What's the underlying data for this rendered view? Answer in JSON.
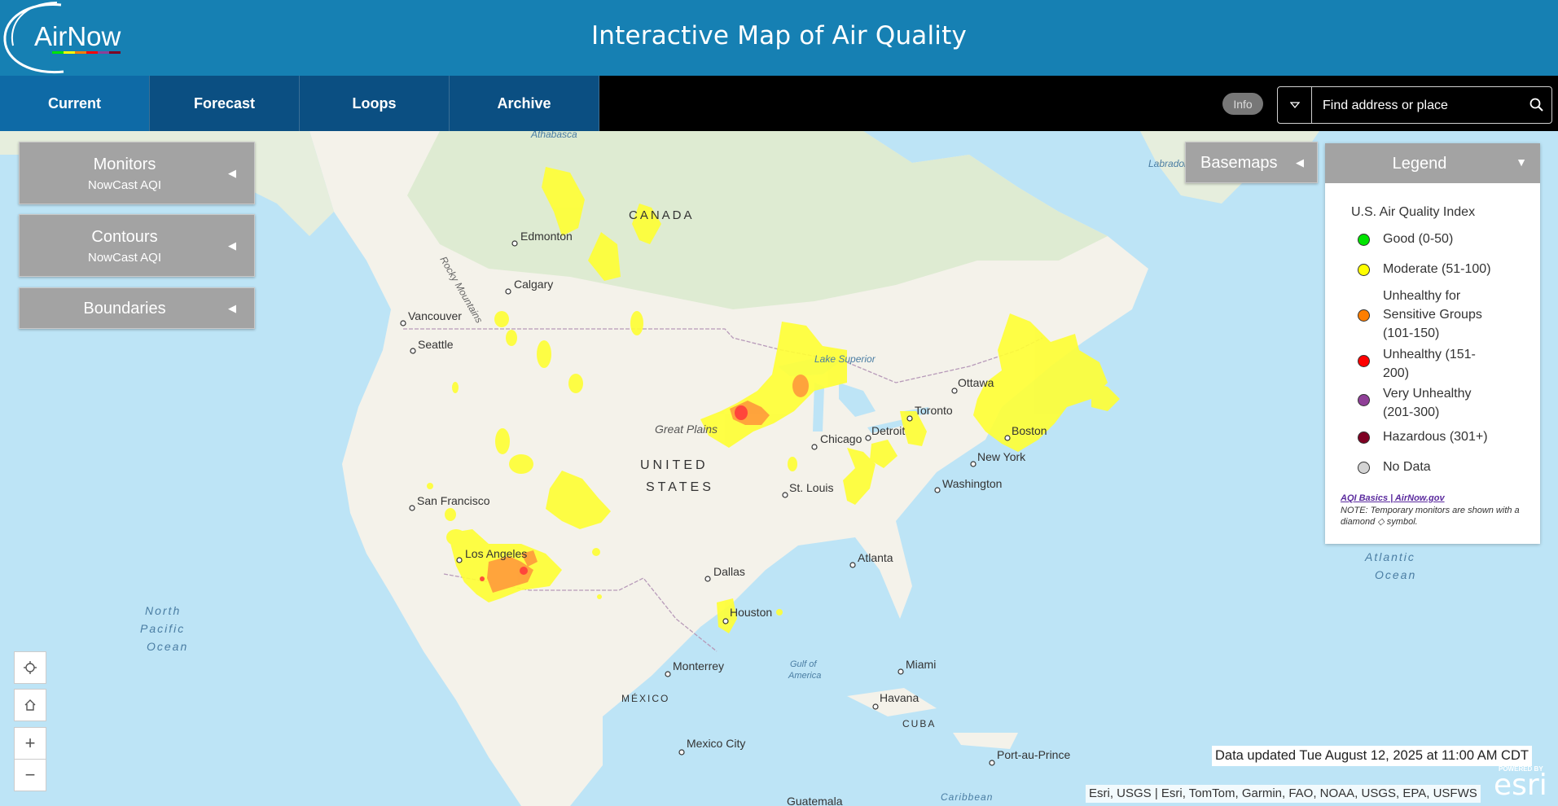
{
  "header": {
    "logo_text": "AirNow",
    "title": "Interactive Map of Air Quality"
  },
  "nav": {
    "tabs": [
      {
        "label": "Current"
      },
      {
        "label": "Forecast"
      },
      {
        "label": "Loops"
      },
      {
        "label": "Archive"
      }
    ],
    "active_tab": "Current"
  },
  "info_button": {
    "label": "Info"
  },
  "search": {
    "placeholder": "Find address or place"
  },
  "panels": {
    "monitors": {
      "title": "Monitors",
      "subtitle": "NowCast AQI"
    },
    "contours": {
      "title": "Contours",
      "subtitle": "NowCast AQI"
    },
    "boundaries": {
      "title": "Boundaries"
    },
    "basemaps": {
      "title": "Basemaps"
    }
  },
  "legend": {
    "title": "Legend",
    "heading": "U.S. Air Quality Index",
    "items": [
      {
        "lines": [
          "Good (0-50)"
        ],
        "color": "#00e400"
      },
      {
        "lines": [
          "Moderate (51-100)"
        ],
        "color": "#ffff00"
      },
      {
        "lines": [
          "Unhealthy for",
          "Sensitive Groups",
          "(101-150)"
        ],
        "color": "#ff7e00"
      },
      {
        "lines": [
          "Unhealthy (151-",
          "200)"
        ],
        "color": "#ff0000"
      },
      {
        "lines": [
          "Very Unhealthy",
          "(201-300)"
        ],
        "color": "#8f3f97"
      },
      {
        "lines": [
          "Hazardous (301+)"
        ],
        "color": "#7e0023"
      },
      {
        "lines": [
          "No Data"
        ],
        "color": "#d3d3d3"
      }
    ],
    "link": "AQI Basics | AirNow.gov",
    "note": "NOTE: Temporary monitors are shown with a diamond",
    "note_end": "symbol."
  },
  "map": {
    "labels": {
      "athabasca": "Athabasca",
      "canada": "CANADA",
      "edmonton": "Edmonton",
      "calgary": "Calgary",
      "vancouver": "Vancouver",
      "seattle": "Seattle",
      "rocky": "Rocky Mountains",
      "labrador_sea": "Labrador Sea",
      "lake_superior": "Lake Superior",
      "ottawa": "Ottawa",
      "toronto": "Toronto",
      "detroit": "Detroit",
      "chicago": "Chicago",
      "boston": "Boston",
      "new_york": "New York",
      "washington": "Washington",
      "great_plains": "Great Plains",
      "united": "UNITED",
      "states": "STATES",
      "st_louis": "St. Louis",
      "san_francisco": "San Francisco",
      "los_angeles": "Los Angeles",
      "dallas": "Dallas",
      "atlanta": "Atlanta",
      "houston": "Houston",
      "north": "North",
      "pacific": "Pacific",
      "ocean_p": "Ocean",
      "atlantic": "Atlantic",
      "ocean_a": "Ocean",
      "monterrey": "Monterrey",
      "gulf": "Gulf of",
      "america": "America",
      "miami": "Miami",
      "havana": "Havana",
      "cuba": "CUBA",
      "mexico": "MÉXICO",
      "mexico_city": "Mexico City",
      "port_au_prince": "Port-au-Prince",
      "guatemala": "Guatemala",
      "caribbean": "Caribbean"
    }
  },
  "status": {
    "updated": "Data updated Tue August 12, 2025 at 11:00 AM CDT",
    "attribution": "Esri, USGS | Esri, TomTom, Garmin, FAO, NOAA, USGS, EPA, USFWS",
    "esri_powered": "POWERED BY",
    "esri": "esri"
  },
  "colors": {
    "header": "#1680b3",
    "tab": "#0b4f82",
    "tab_active": "#0e6aa6",
    "moderate": "#ffff00",
    "usg": "#ff7e00",
    "unhealthy": "#ff0000"
  }
}
